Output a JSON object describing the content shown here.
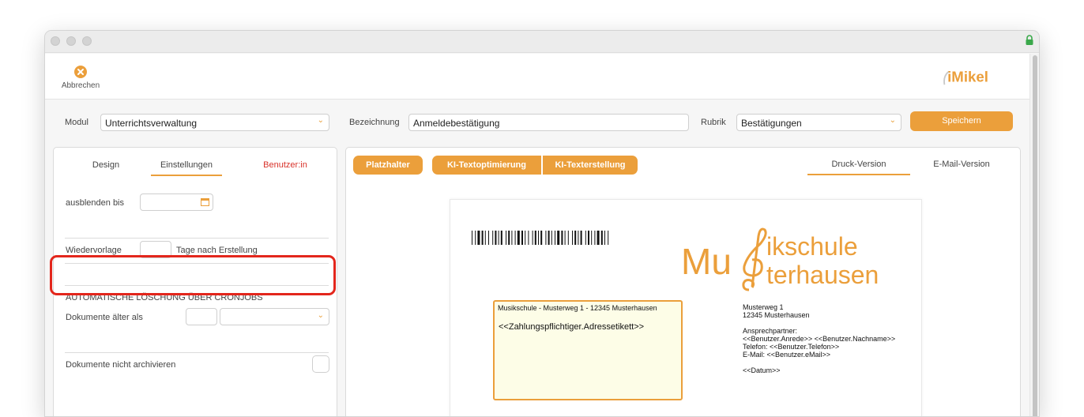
{
  "toolbar": {
    "cancel_label": "Abbrechen",
    "logo_text": "iMikel"
  },
  "form": {
    "modul_label": "Modul",
    "modul_value": "Unterrichtsverwaltung",
    "bezeichnung_label": "Bezeichnung",
    "bezeichnung_value": "Anmeldebestätigung",
    "rubrik_label": "Rubrik",
    "rubrik_value": "Bestätigungen",
    "save_label": "Speichern"
  },
  "left_tabs": {
    "design": "Design",
    "einstellungen": "Einstellungen",
    "benutzer": "Benutzer:in",
    "active": "Einstellungen"
  },
  "settings": {
    "ausblenden_label": "ausblenden bis",
    "wiedervorlage_label": "Wiedervorlage",
    "wiedervorlage_suffix": "Tage nach Erstellung",
    "cron_heading": "AUTOMATISCHE LÖSCHUNG ÜBER CRONJOBS",
    "dokumente_aelter_label": "Dokumente älter als",
    "nicht_archivieren_label": "Dokumente nicht archivieren"
  },
  "editor": {
    "platzhalter": "Platzhalter",
    "ki_optimierung": "KI-Textoptimierung",
    "ki_erstellung": "KI-Texterstellung",
    "druck_version": "Druck-Version",
    "email_version": "E-Mail-Version",
    "active_version": "Druck-Version"
  },
  "document": {
    "logo_line1": "ikschule",
    "logo_line2": "terhausen",
    "logo_prefix": "Mu",
    "sender_line": "Musikschule - Musterweg 1 - 12345 Musterhausen",
    "address_placeholder": "<<Zahlungspflichtiger.Adressetikett>>",
    "street": "Musterweg 1",
    "city": "12345 Musterhausen",
    "contact_label": "Ansprechpartner:",
    "contact_name": "<<Benutzer.Anrede>> <<Benutzer.Nachname>>",
    "phone": "Telefon: <<Benutzer.Telefon>>",
    "email": "E-Mail: <<Benutzer.eMail>>",
    "date": "<<Datum>>"
  },
  "colors": {
    "accent": "#eb9f3b",
    "highlight": "#e3261c",
    "tab_red": "#d8322a"
  }
}
